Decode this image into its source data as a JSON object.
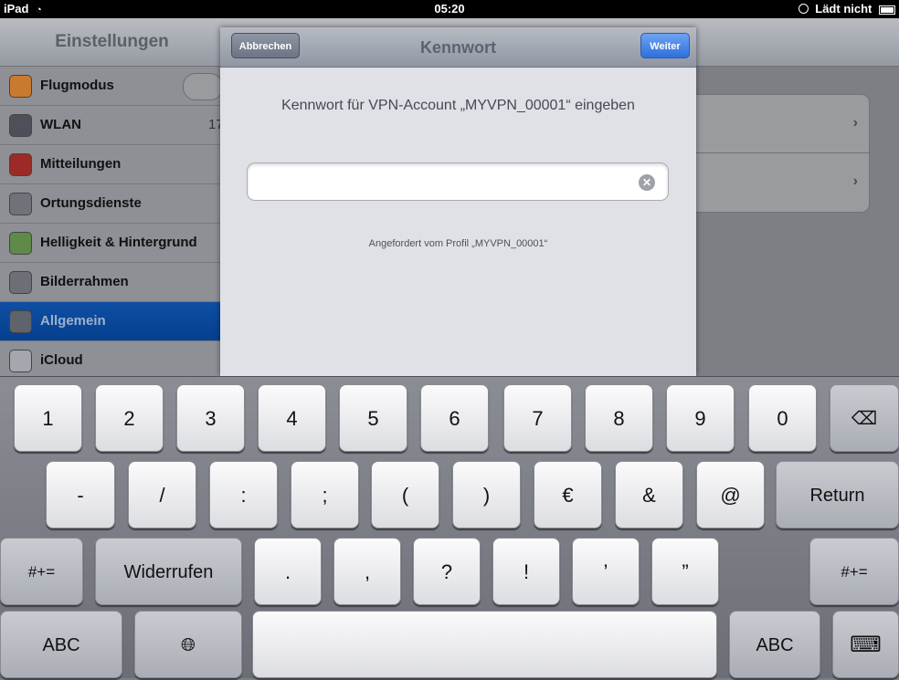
{
  "status_bar": {
    "device": "iPad",
    "time": "05:20",
    "charging": "Lädt nicht"
  },
  "settings": {
    "title": "Einstellungen",
    "items": [
      {
        "label": "Flugmodus",
        "value": "",
        "icon": "airplane-icon",
        "color": "#e9862a"
      },
      {
        "label": "WLAN",
        "value": "17",
        "icon": "wifi-icon",
        "color": "#2e71d6"
      },
      {
        "label": "Mitteilungen",
        "value": "",
        "icon": "notifications-icon",
        "color": "#c8322d"
      },
      {
        "label": "Ortungsdienste",
        "value": "",
        "icon": "location-icon",
        "color": "#8d9298"
      },
      {
        "label": "Helligkeit & Hintergrund",
        "value": "",
        "icon": "flower-icon",
        "color": "#6aa352"
      },
      {
        "label": "Bilderrahmen",
        "value": "",
        "icon": "picture-frame-icon",
        "color": "#8a8e94"
      },
      {
        "label": "Allgemein",
        "value": "",
        "icon": "gear-icon",
        "color": "#7b8088"
      },
      {
        "label": "iCloud",
        "value": "",
        "icon": "cloud-icon",
        "color": "#c9ccd2"
      }
    ]
  },
  "modal": {
    "cancel_label": "Abbrechen",
    "title": "Kennwort",
    "next_label": "Weiter",
    "prompt": "Kennwort für VPN-Account „MYVPN_00001“ eingeben",
    "password_value": "",
    "footer": "Angefordert vom Profil „MYVPN_00001“"
  },
  "keyboard": {
    "row1": [
      "1",
      "2",
      "3",
      "4",
      "5",
      "6",
      "7",
      "8",
      "9",
      "0"
    ],
    "row2": [
      "-",
      "/",
      ":",
      ";",
      "(",
      ")",
      "€",
      "&",
      "@"
    ],
    "return_label": "Return",
    "row3_symbols": [
      ".",
      ",",
      "?",
      "!",
      "’",
      "”"
    ],
    "shift_label": "#+=",
    "undo_label": "Widerrufen",
    "abc_label": "ABC"
  }
}
